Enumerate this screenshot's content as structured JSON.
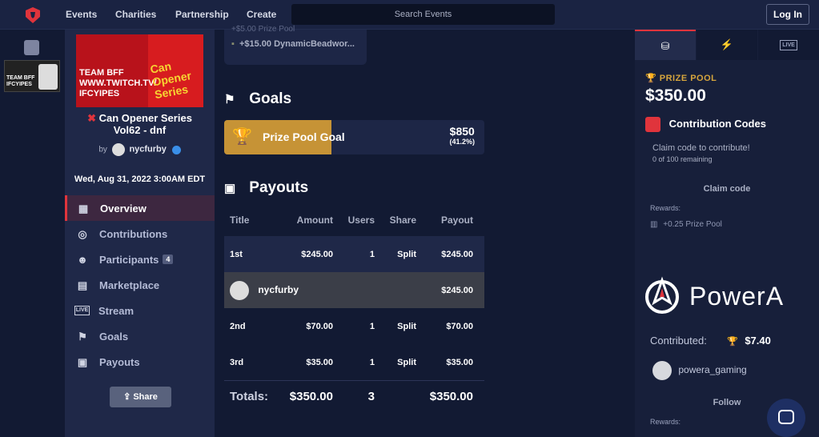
{
  "header": {
    "nav": [
      "Events",
      "Charities",
      "Partnership",
      "Create"
    ],
    "search_placeholder": "Search Events",
    "login_label": "Log In"
  },
  "event": {
    "poster": {
      "text_left": "TEAM BFF\nWWW.TWITCH.TV/\nIFCYIPES",
      "text_right": "Can Opener Series"
    },
    "title": "Can Opener Series Vol62 - dnf",
    "by_label": "by",
    "organizer": "nycfurby",
    "date": "Wed, Aug 31, 2022 3:00AM EDT"
  },
  "sidebar": {
    "items": [
      {
        "label": "Overview",
        "icon": "grid-icon"
      },
      {
        "label": "Contributions",
        "icon": "coins-icon"
      },
      {
        "label": "Participants",
        "icon": "users-icon",
        "badge": "4"
      },
      {
        "label": "Marketplace",
        "icon": "store-icon"
      },
      {
        "label": "Stream",
        "icon": "live-icon"
      },
      {
        "label": "Goals",
        "icon": "flag-icon"
      },
      {
        "label": "Payouts",
        "icon": "money-icon"
      }
    ],
    "share_label": "Share"
  },
  "main": {
    "prev_card": {
      "row1": "+$5.00 Prize Pool",
      "row2": "+$15.00 DynamicBeadwor..."
    },
    "goals_title": "Goals",
    "goal": {
      "label": "Prize Pool Goal",
      "amount": "$850",
      "percent": "(41.2%)",
      "progress": 0.412
    },
    "payouts_title": "Payouts",
    "payout_headers": [
      "Title",
      "Amount",
      "Users",
      "Share",
      "Payout"
    ],
    "payout_rows": [
      {
        "title": "1st",
        "amount": "$245.00",
        "users": "1",
        "share": "Split",
        "payout": "$245.00"
      },
      {
        "title": "nycfurby",
        "amount": "",
        "users": "",
        "share": "",
        "payout": "$245.00"
      },
      {
        "title": "2nd",
        "amount": "$70.00",
        "users": "1",
        "share": "Split",
        "payout": "$70.00"
      },
      {
        "title": "3rd",
        "amount": "$35.00",
        "users": "1",
        "share": "Split",
        "payout": "$35.00"
      }
    ],
    "totals": {
      "label": "Totals:",
      "amount": "$350.00",
      "users": "3",
      "payout": "$350.00"
    }
  },
  "right": {
    "tabs": [
      "prize-icon",
      "bolt-icon",
      "LIVE"
    ],
    "prize_pool_label": "PRIZE POOL",
    "prize_pool_amount": "$350.00",
    "contribution_codes_title": "Contribution Codes",
    "claim_text": "Claim code to contribute!",
    "claim_remaining": "0 of 100 remaining",
    "claim_code_label": "Claim code",
    "rewards_label": "Rewards:",
    "reward_item": "+0.25 Prize Pool",
    "sponsor_brand": "PowerA",
    "contributed_label": "Contributed:",
    "contributed_amount": "$7.40",
    "sponsor_user": "powera_gaming",
    "follow_label": "Follow",
    "rewards_label_2": "Rewards:"
  },
  "colors": {
    "accent": "#e0343c",
    "gold": "#c69336",
    "bg": "#121a33"
  }
}
